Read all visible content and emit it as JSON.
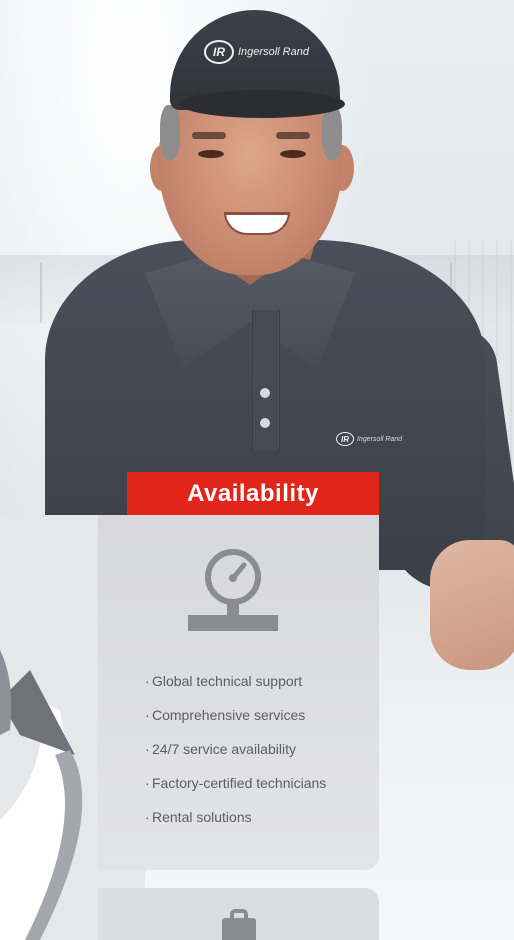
{
  "brand": {
    "cap_text": "Ingersoll Rand",
    "shirt_text": "Ingersoll Rand",
    "logo_mark": "IR"
  },
  "card": {
    "title": "Availability",
    "title_bg_color": "#e1251b",
    "icon": "pressure-gauge-icon",
    "features": [
      "Global technical support",
      "Comprehensive services",
      "24/7 service availability",
      "Factory-certified technicians",
      "Rental solutions"
    ]
  },
  "next_card": {
    "icon": "clipboard-icon"
  },
  "colors": {
    "accent_red": "#e1251b",
    "card_gray": "#d7d8db",
    "icon_gray": "#8a8c91",
    "text_gray": "#5a5d63"
  }
}
